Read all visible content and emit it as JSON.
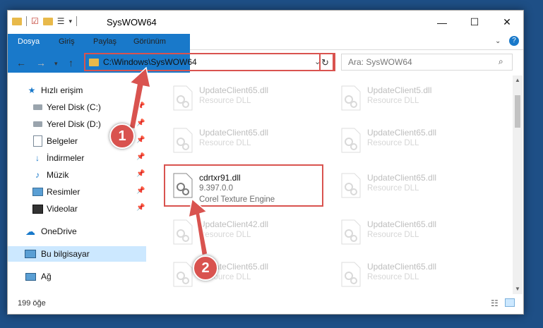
{
  "window": {
    "title": "SysWOW64",
    "controls": {
      "minimize": "—",
      "maximize": "☐",
      "close": "✕"
    }
  },
  "ribbon": {
    "tabs": [
      "Dosya",
      "Giriş",
      "Paylaş",
      "Görünüm"
    ]
  },
  "address": {
    "path": "C:\\Windows\\SysWOW64"
  },
  "search": {
    "placeholder": "Ara: SysWOW64"
  },
  "sidebar": {
    "items": [
      {
        "label": "Hızlı erişim",
        "icon": "star-icon",
        "pinned": false
      },
      {
        "label": "Yerel Disk (C:)",
        "icon": "drive-icon",
        "pinned": true
      },
      {
        "label": "Yerel Disk (D:)",
        "icon": "drive-icon",
        "pinned": true
      },
      {
        "label": "Belgeler",
        "icon": "documents-icon",
        "pinned": true
      },
      {
        "label": "İndirmeler",
        "icon": "download-icon",
        "pinned": true
      },
      {
        "label": "Müzik",
        "icon": "music-icon",
        "pinned": true
      },
      {
        "label": "Resimler",
        "icon": "pictures-icon",
        "pinned": true
      },
      {
        "label": "Videolar",
        "icon": "videos-icon",
        "pinned": true
      },
      {
        "label": "OneDrive",
        "icon": "cloud-icon",
        "pinned": false
      },
      {
        "label": "Bu bilgisayar",
        "icon": "computer-icon",
        "pinned": false
      },
      {
        "label": "Ağ",
        "icon": "network-icon",
        "pinned": false
      }
    ]
  },
  "files": [
    {
      "name": "UpdateClient65.dll",
      "type": "Resource DLL"
    },
    {
      "name": "UpdateClient5.dll",
      "type": "Resource DLL"
    },
    {
      "name": "UpdateClient65.dll",
      "type": "Resource DLL"
    },
    {
      "name": "UpdateClient65.dll",
      "type": "Resource DLL"
    },
    {
      "name": "cdrtxr91.dll",
      "version": "9.397.0.0",
      "description": "Corel Texture Engine"
    },
    {
      "name": "UpdateClient65.dll",
      "type": "Resource DLL"
    },
    {
      "name": "UpdateClient42.dll",
      "type": "Resource DLL"
    },
    {
      "name": "UpdateClient65.dll",
      "type": "Resource DLL"
    },
    {
      "name": "UpdateClient65.dll",
      "type": "Resource DLL"
    },
    {
      "name": "UpdateClient65.dll",
      "type": "Resource DLL"
    }
  ],
  "status": {
    "count": "199 öğe"
  },
  "callouts": [
    "1",
    "2"
  ],
  "colors": {
    "accent": "#1979ca",
    "highlight": "#d9534f",
    "selection": "#cce8ff",
    "desktop": "#1e4f86"
  }
}
